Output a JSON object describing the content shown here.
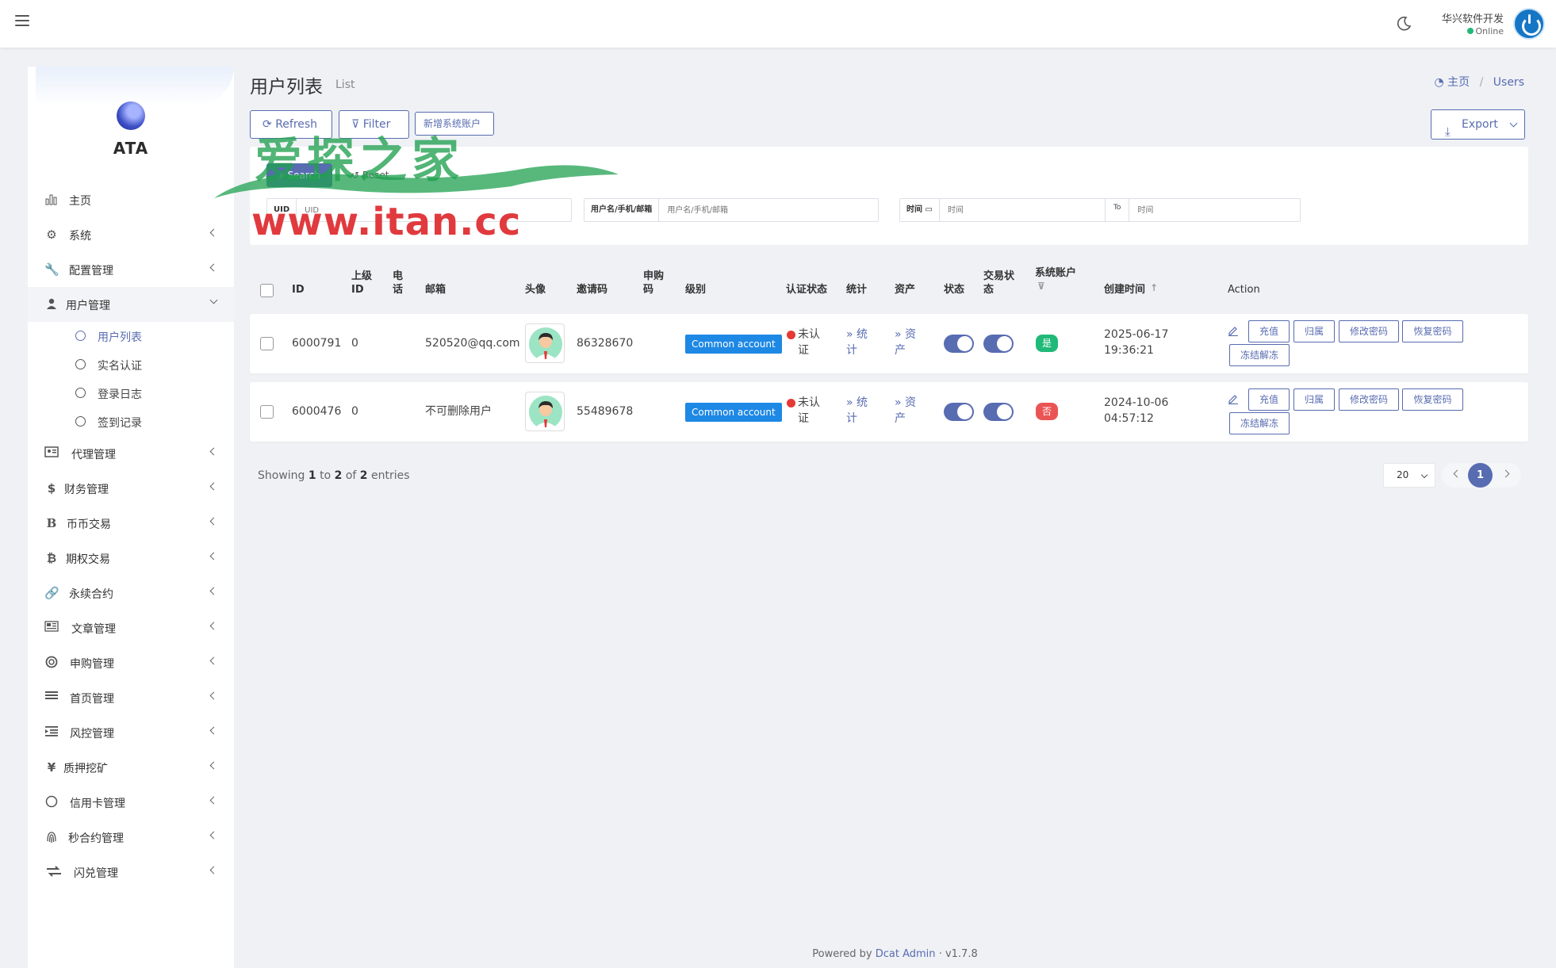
{
  "navbar": {
    "user_name": "华兴软件开发",
    "user_status": "Online"
  },
  "sidebar": {
    "logo_text": "ATA",
    "items": [
      {
        "label": "主页",
        "icon": "bar-chart-icon"
      },
      {
        "label": "系统",
        "icon": "gear-icon"
      },
      {
        "label": "配置管理",
        "icon": "wrench-icon"
      },
      {
        "label": "用户管理",
        "icon": "user-icon"
      },
      {
        "label": "代理管理",
        "icon": "id-card-icon"
      },
      {
        "label": "财务管理",
        "icon": "dollar-icon"
      },
      {
        "label": "币币交易",
        "icon": "b-letter-icon"
      },
      {
        "label": "期权交易",
        "icon": "bitcoin-icon"
      },
      {
        "label": "永续合约",
        "icon": "link-icon"
      },
      {
        "label": "文章管理",
        "icon": "newspaper-icon"
      },
      {
        "label": "申购管理",
        "icon": "life-ring-icon"
      },
      {
        "label": "首页管理",
        "icon": "list-icon"
      },
      {
        "label": "风控管理",
        "icon": "indent-icon"
      },
      {
        "label": "质押挖矿",
        "icon": "yen-icon"
      },
      {
        "label": "信用卡管理",
        "icon": "circle-icon"
      },
      {
        "label": "秒合约管理",
        "icon": "fingerprint-icon"
      },
      {
        "label": "闪兑管理",
        "icon": "exchange-icon"
      }
    ],
    "submenu": [
      "用户列表",
      "实名认证",
      "登录日志",
      "签到记录"
    ]
  },
  "page": {
    "title": "用户列表",
    "subtitle": "List",
    "breadcrumb_home": "主页",
    "breadcrumb_current": "Users"
  },
  "toolbar": {
    "refresh": "Refresh",
    "filter": "Filter",
    "new_system_account": "新增系统账户",
    "export": "Export"
  },
  "filter": {
    "search": "Search",
    "reset": "Reset",
    "uid_label": "UID",
    "uid_placeholder": "UID",
    "user_label": "用户名/手机/邮箱",
    "user_placeholder": "用户名/手机/邮箱",
    "time_label": "时间",
    "time_placeholder": "时间",
    "to_label": "To",
    "time_to_placeholder": "时间"
  },
  "table": {
    "headers": {
      "id": "ID",
      "parent_id": "上级ID",
      "phone": "电话",
      "email": "邮箱",
      "avatar": "头像",
      "invite_code": "邀请码",
      "purchase_code": "申购码",
      "level": "级别",
      "auth_status": "认证状态",
      "stats": "统计",
      "assets": "资产",
      "status": "状态",
      "trade_status": "交易状态",
      "system_account": "系统账户",
      "created_at": "创建时间",
      "action": "Action"
    },
    "rows": [
      {
        "id": "6000791",
        "parent_id": "0",
        "phone": "",
        "email": "520520@qq.com",
        "invite_code": "86328670",
        "purchase_code": "",
        "level": "Common account",
        "auth_status": "未认证",
        "stats": "» 统计",
        "assets": "» 资产",
        "status_on": true,
        "trade_status_on": true,
        "system_account": "是",
        "system_account_color": "#21b978",
        "created_date": "2025-06-17",
        "created_time": "19:36:21"
      },
      {
        "id": "6000476",
        "parent_id": "0",
        "phone": "",
        "email": "不可删除用户",
        "invite_code": "55489678",
        "purchase_code": "",
        "level": "Common account",
        "auth_status": "未认证",
        "stats": "» 统计",
        "assets": "» 资产",
        "status_on": true,
        "trade_status_on": true,
        "system_account": "否",
        "system_account_color": "#ea5455",
        "created_date": "2024-10-06",
        "created_time": "04:57:12"
      }
    ],
    "actions": [
      "充值",
      "归属",
      "修改密码",
      "恢复密码",
      "冻结解冻"
    ]
  },
  "pagination": {
    "showing_prefix": "Showing",
    "from": "1",
    "to_word": "to",
    "to": "2",
    "of_word": "of",
    "total": "2",
    "entries_word": "entries",
    "per_page": "20",
    "current_page": "1"
  },
  "footer": {
    "powered_by": "Powered by",
    "brand": "Dcat Admin",
    "version": "v1.7.8"
  },
  "watermark": {
    "logo_text": "爱探之家",
    "url": "www.itan.cc"
  },
  "colors": {
    "primary": "#586cb1",
    "badge_blue": "#1e88e5",
    "danger": "#e53935",
    "success": "#21b978",
    "background": "#eff1f5"
  }
}
